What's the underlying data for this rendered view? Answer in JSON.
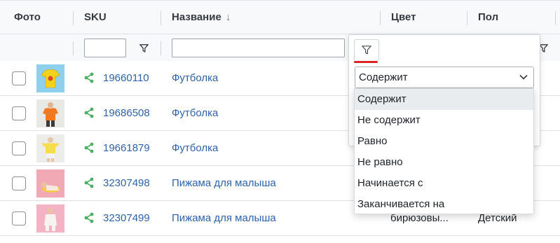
{
  "columns": {
    "photo": "Фото",
    "sku": "SKU",
    "name": "Название",
    "name_sort_icon": "↓",
    "color": "Цвет",
    "gender": "Пол"
  },
  "filter_panel": {
    "selected_operator": "Содержит",
    "accent_color": "#dc2626",
    "operators": [
      "Содержит",
      "Не содержит",
      "Равно",
      "Не равно",
      "Начинается с",
      "Заканчивается на"
    ]
  },
  "rows": [
    {
      "sku": "19660110",
      "name": "Футболка",
      "photo": "yellow-tshirt",
      "color": "",
      "gender": ""
    },
    {
      "sku": "19686508",
      "name": "Футболка",
      "photo": "orange-tshirt",
      "color": "",
      "gender": ""
    },
    {
      "sku": "19661879",
      "name": "Футболка",
      "photo": "child-yellow-tshirt",
      "color": "",
      "gender": ""
    },
    {
      "sku": "32307498",
      "name": "Пижама для малыша",
      "photo": "baby-pajama-pink",
      "color": "",
      "gender": ""
    },
    {
      "sku": "32307499",
      "name": "Пижама для малыша",
      "photo": "baby-pajama-pink",
      "color": "бирюзовы...",
      "gender": "Детский"
    }
  ]
}
